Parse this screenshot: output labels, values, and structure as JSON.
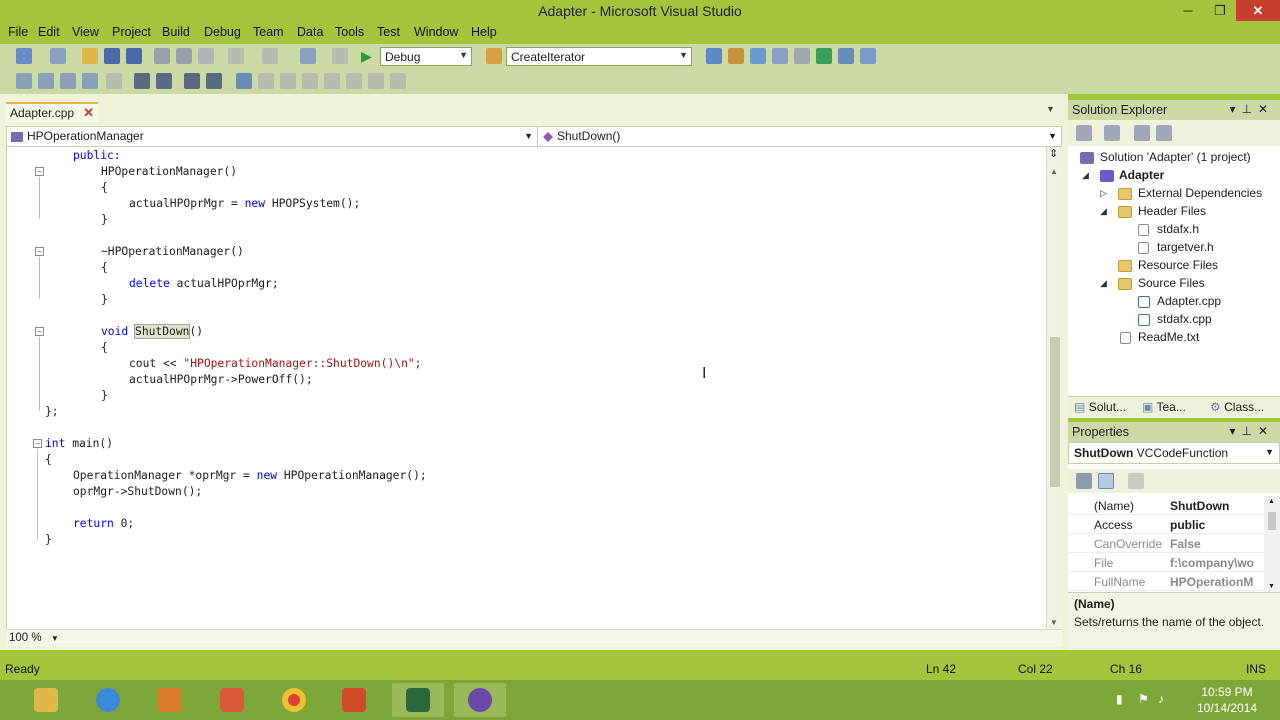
{
  "window": {
    "title": "Adapter - Microsoft Visual Studio",
    "min": "─",
    "restore": "❐",
    "close": "✕"
  },
  "menu": [
    "File",
    "Edit",
    "View",
    "Project",
    "Build",
    "Debug",
    "Team",
    "Data",
    "Tools",
    "Test",
    "Window",
    "Help"
  ],
  "toolbar": {
    "config": "Debug",
    "find_combo": "CreateIterator"
  },
  "editor": {
    "tab_label": "Adapter.cpp",
    "tab_close": "✕",
    "class_combo": "HPOperationManager",
    "member_combo": "ShutDown()",
    "zoom": "100 %",
    "code": {
      "l1": "public:",
      "l2": "HPOperationManager()",
      "l3": "{",
      "l4a": "actualHPOprMgr = ",
      "l4b": "new",
      "l4c": " HPOPSystem();",
      "l5": "}",
      "l6": "~HPOperationManager()",
      "l7": "{",
      "l8a": "delete",
      "l8b": " actualHPOprMgr;",
      "l9": "}",
      "l10a": "void",
      "l10b": "ShutDown",
      "l10c": "()",
      "l11": "{",
      "l12a": "cout << ",
      "l12b": "\"HPOperationManager::ShutDown()\\n\"",
      "l12c": ";",
      "l13": "actualHPOprMgr->PowerOff();",
      "l14": "}",
      "l15": "};",
      "l16a": "int",
      "l16b": " main()",
      "l17": "{",
      "l18a": "OperationManager *oprMgr = ",
      "l18b": "new",
      "l18c": " HPOperationManager();",
      "l19": "oprMgr->ShutDown();",
      "l20a": "return",
      "l20b": " 0;",
      "l21": "}"
    }
  },
  "solution_explorer": {
    "title": "Solution Explorer",
    "items": {
      "solution": "Solution 'Adapter' (1 project)",
      "project": "Adapter",
      "ext_deps": "External Dependencies",
      "header_files": "Header Files",
      "stdafx_h": "stdafx.h",
      "targetver_h": "targetver.h",
      "resource_files": "Resource Files",
      "source_files": "Source Files",
      "adapter_cpp": "Adapter.cpp",
      "stdafx_cpp": "stdafx.cpp",
      "readme": "ReadMe.txt"
    },
    "tabs": [
      "Solut...",
      "Tea...",
      "Class..."
    ]
  },
  "properties": {
    "title": "Properties",
    "object_name": "ShutDown",
    "object_type": "VCCodeFunction",
    "rows": [
      {
        "name": "(Name)",
        "value": "ShutDown"
      },
      {
        "name": "Access",
        "value": "public"
      },
      {
        "name": "CanOverride",
        "value": "False"
      },
      {
        "name": "File",
        "value": "f:\\company\\wo"
      },
      {
        "name": "FullName",
        "value": "HPOperationM"
      }
    ],
    "desc_title": "(Name)",
    "desc_text": "Sets/returns the name of the object."
  },
  "status": {
    "state": "Ready",
    "ln": "Ln 42",
    "col": "Col 22",
    "ch": "Ch 16",
    "mode": "INS"
  },
  "taskbar": {
    "time": "10:59 PM",
    "date": "10/14/2014"
  }
}
